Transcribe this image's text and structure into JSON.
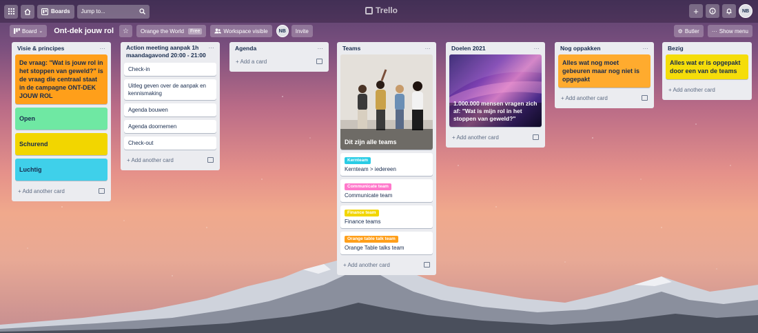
{
  "topbar": {
    "boards_label": "Boards",
    "search_placeholder": "Jump to...",
    "logo_text": "Trello",
    "avatar_initials": "NB"
  },
  "boardbar": {
    "view_label": "Board",
    "title": "Ont-dek jouw rol",
    "workspace": "Orange the World",
    "workspace_badge": "Free",
    "visibility": "Workspace visible",
    "member_initials": "NB",
    "invite_label": "Invite",
    "butler_label": "Butler",
    "show_menu_label": "Show menu"
  },
  "lists": [
    {
      "title": "Visie & principes",
      "cards": [
        {
          "text": "De vraag: \"Wat is jouw rol in het stoppen van geweld?\" is de vraag die centraal staat in de campagne ONT-DEK JOUW ROL",
          "color": "#ff9f1a"
        },
        {
          "text": "Open",
          "color": "#61bd4f"
        },
        {
          "text": "Schurend",
          "color": "#f2d600"
        },
        {
          "text": "Luchtig",
          "color": "#29cce5"
        }
      ],
      "add_label": "Add another card"
    },
    {
      "title": "Action meeting aanpak 1h maandagavond 20:00 - 21:00",
      "cards": [
        {
          "text": "Check-in"
        },
        {
          "text": "Uitleg geven over de aanpak en kennismaking"
        },
        {
          "text": "Agenda bouwen"
        },
        {
          "text": "Agenda doornemen"
        },
        {
          "text": "Check-out"
        }
      ],
      "add_label": "Add another card"
    },
    {
      "title": "Agenda",
      "cards": [],
      "add_label": "Add a card"
    },
    {
      "title": "Teams",
      "cover": {
        "text": "Dit zijn alle teams"
      },
      "cards": [
        {
          "label": "Kernteam",
          "label_color": "#29cce5",
          "text": "Kernteam > iedereen"
        },
        {
          "label": "Communicate team",
          "label_color": "#ff78cb",
          "text": "Communicate team"
        },
        {
          "label": "Finance team",
          "label_color": "#f2d600",
          "text": "Finance teams"
        },
        {
          "label": "Orange table talk team",
          "label_color": "#ff9f1a",
          "text": "Orange Table talks team"
        }
      ],
      "add_label": "Add another card"
    },
    {
      "title": "Doelen 2021",
      "cover": {
        "text": "1.000.000 mensen vragen zich af: \"Wat is mijn rol in het stoppen van geweld?\""
      },
      "cards": [],
      "add_label": "Add another card"
    },
    {
      "title": "Nog oppakken",
      "cards": [
        {
          "text": "Alles wat nog moet gebeuren maar nog niet is opgepakt",
          "color": "#ff9f1a"
        }
      ],
      "add_label": "Add another card"
    },
    {
      "title": "Bezig",
      "cards": [
        {
          "text": "Alles wat er is opgepakt door een van de teams",
          "color": "#f2d600"
        }
      ],
      "add_label": "Add another card"
    }
  ]
}
